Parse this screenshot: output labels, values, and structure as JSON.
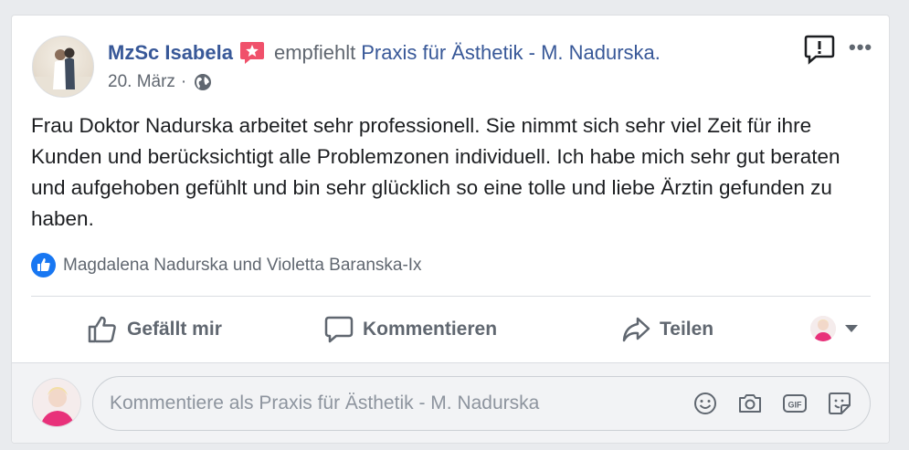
{
  "post": {
    "author": "MzSc Isabela",
    "action_text": "empfiehlt",
    "page_name": "Praxis für Ästhetik - M. Nadurska.",
    "date": "20. März",
    "separator": "·",
    "privacy_icon": "globe-icon",
    "text": "Frau Doktor Nadurska arbeitet sehr professionell. Sie nimmt sich sehr viel Zeit für ihre Kunden und berücksichtigt alle Problemzonen individuell. Ich habe mich sehr gut beraten und aufgehoben gefühlt und bin sehr glücklich so eine tolle und liebe Ärztin gefunden zu haben."
  },
  "reactions": {
    "icon": "like-icon",
    "names": "Magdalena Nadurska und Violetta Baranska-Ix"
  },
  "actions": {
    "like_label": "Gefällt mir",
    "comment_label": "Kommentieren",
    "share_label": "Teilen"
  },
  "comment": {
    "placeholder": "Kommentiere als Praxis für Ästhetik - M. Nadurska",
    "icons": [
      "emoji-icon",
      "camera-icon",
      "gif-icon",
      "sticker-icon"
    ]
  },
  "colors": {
    "link": "#385898",
    "secondary_text": "#606770",
    "like_blue": "#1877f2",
    "badge_pink": "#f0516b"
  }
}
